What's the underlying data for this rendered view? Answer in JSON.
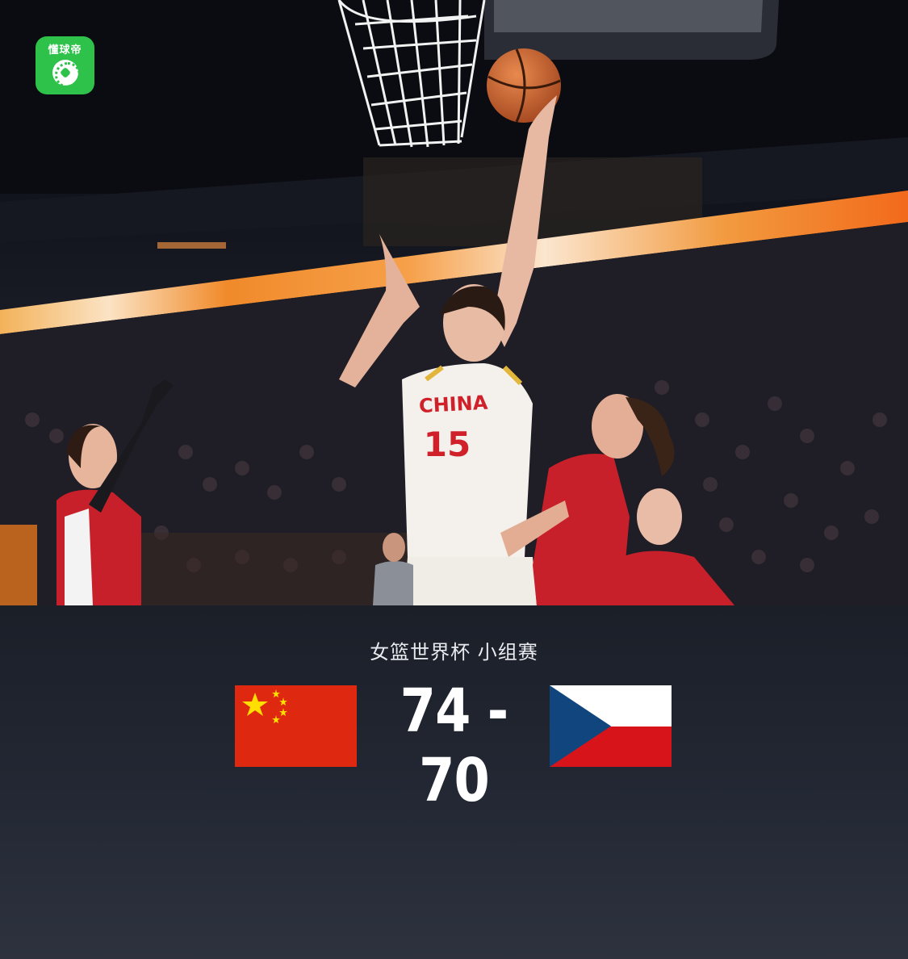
{
  "app": {
    "logo_text": "懂球帝",
    "logo_icon": "football-icon",
    "brand_color": "#2ec24a"
  },
  "photo": {
    "jersey_text": "CHINA",
    "jersey_number": "15"
  },
  "match": {
    "event": "女篮世界杯 小组赛",
    "home_score": "74",
    "separator": "-",
    "away_score": "70",
    "home_team": {
      "flag": "china-flag",
      "flag_color": "#de2910"
    },
    "away_team": {
      "flag": "czech-flag",
      "colors": [
        "#ffffff",
        "#d7141a",
        "#11457e"
      ]
    }
  }
}
